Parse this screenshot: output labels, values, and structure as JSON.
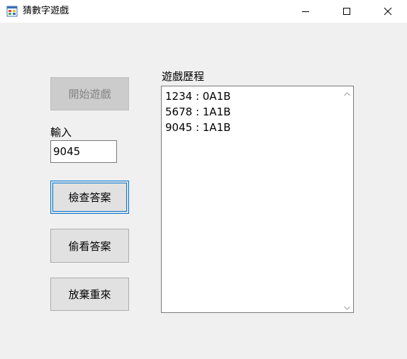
{
  "window": {
    "title": "猜數字遊戲"
  },
  "controls": {
    "start_button": "開始遊戲",
    "input_label": "輸入",
    "input_value": "9045",
    "check_button": "檢查答案",
    "peek_button": "偷看答案",
    "giveup_button": "放棄重來"
  },
  "history": {
    "label": "遊戲歷程",
    "entries": [
      "1234 : 0A1B",
      "5678 : 1A1B",
      "9045 : 1A1B"
    ]
  },
  "icons": {
    "app": "app-window-icon",
    "minimize": "minimize-icon",
    "maximize": "maximize-icon",
    "close": "close-icon",
    "scroll_up": "chevron-up-icon",
    "scroll_down": "chevron-down-icon"
  },
  "colors": {
    "window_bg": "#f0f0f0",
    "focus_border": "#0078d7",
    "button_bg": "#e1e1e1",
    "disabled_text": "#838383"
  }
}
